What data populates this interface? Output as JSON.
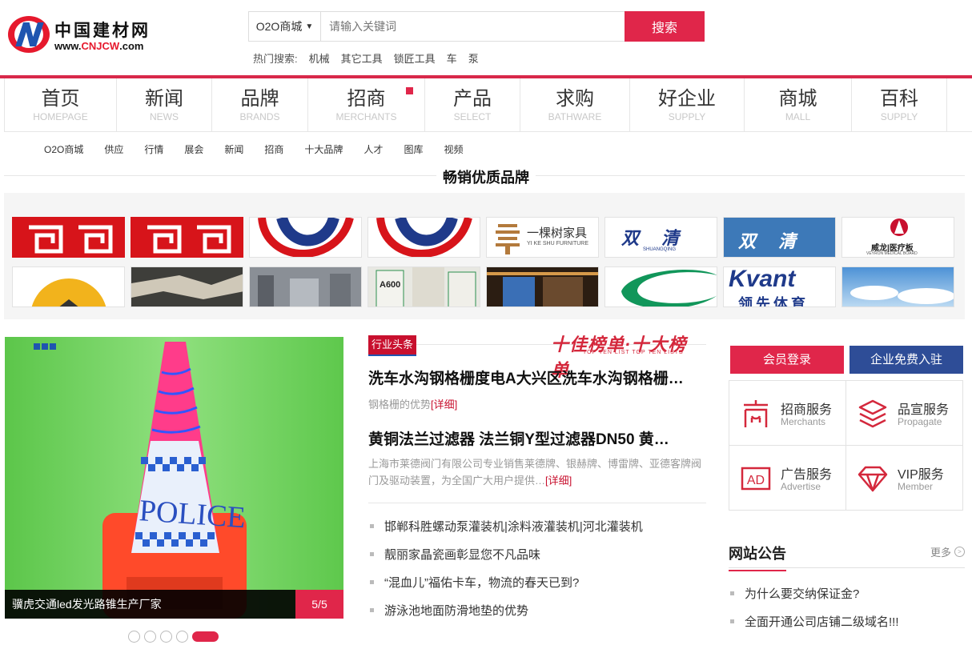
{
  "header": {
    "logo_cn": "中国建材网",
    "logo_url_prefix": "www.",
    "logo_url_brand": "CNJCW",
    "logo_url_suffix": ".com",
    "search_scope": "O2O商城",
    "search_placeholder": "请输入关键词",
    "search_button": "搜索",
    "hot_label": "热门搜索:",
    "hot_terms": [
      "机械",
      "其它工具",
      "锁匠工具",
      "车",
      "泵"
    ]
  },
  "main_nav": [
    {
      "zh": "首页",
      "en": "HOMEPAGE"
    },
    {
      "zh": "新闻",
      "en": "NEWS"
    },
    {
      "zh": "品牌",
      "en": "BRANDS"
    },
    {
      "zh": "招商",
      "en": "MERCHANTS"
    },
    {
      "zh": "产品",
      "en": "SELECT"
    },
    {
      "zh": "求购",
      "en": "BATHWARE"
    },
    {
      "zh": "好企业",
      "en": "SUPPLY"
    },
    {
      "zh": "商城",
      "en": "MALL"
    },
    {
      "zh": "百科",
      "en": "SUPPLY"
    }
  ],
  "sub_nav": [
    "O2O商城",
    "供应",
    "行情",
    "展会",
    "新闻",
    "招商",
    "十大品牌",
    "人才",
    "图库",
    "视频"
  ],
  "brand_section": {
    "title": "畅销优质品牌",
    "logo_texts": {
      "yikeshu": "一棵树家具",
      "yikeshu_en": "YI KE SHU FURNITURE",
      "shuangqing": "双清",
      "shuangqing_en": "SHUANGQING",
      "weilong": "威龙|医疗板",
      "weilong_en": "VEYRON MEDICAL BOARD",
      "kvant": "Kvant",
      "kvant_cn": "领先体育",
      "a600": "A600"
    }
  },
  "slider": {
    "caption": "骥虎交通led发光路锥生产厂家",
    "counter": "5/5",
    "image_text": "POLICE",
    "dot_count": 5,
    "active_index": 4
  },
  "news": {
    "tag": "行业头条",
    "banner_title": "十佳榜单·十大榜单",
    "banner_sub": "TOP TEN LIST   TOP TEN LISTS",
    "headline1": "洗车水沟钢格栅度电A大兴区洗车水沟钢格栅…",
    "desc1": "钢格栅的优势",
    "headline2": "黄铜法兰过滤器 法兰铜Y型过滤器DN50 黄…",
    "desc2": "上海市莱德阀门有限公司专业销售莱德牌、银赫牌、博雷牌、亚德客牌阀门及驱动装置，为全国广大用户提供…",
    "detail_link": "[详细]",
    "list": [
      "邯郸科胜螺动泵灌装机|涂料液灌装机|河北灌装机",
      "靓丽家晶瓷画彰显您不凡品味",
      "“混血儿”福佑卡车，物流的春天已到?",
      "游泳池地面防滑地垫的优势"
    ]
  },
  "sidebar": {
    "login": "会员登录",
    "join": "企业免费入驻",
    "services": [
      {
        "name": "招商服务",
        "en": "Merchants",
        "icon": "merchants-icon"
      },
      {
        "name": "品宣服务",
        "en": "Propagate",
        "icon": "layers-icon"
      },
      {
        "name": "广告服务",
        "en": "Advertise",
        "icon": "ad-icon"
      },
      {
        "name": "VIP服务",
        "en": "Member",
        "icon": "diamond-icon"
      }
    ],
    "notice_title": "网站公告",
    "notice_more": "更多",
    "notices": [
      "为什么要交纳保证金?",
      "全面开通公司店铺二级域名!!!"
    ]
  },
  "colors": {
    "accent": "#e0264a",
    "navy": "#2e4d97",
    "red_bar": "#d8284a"
  }
}
